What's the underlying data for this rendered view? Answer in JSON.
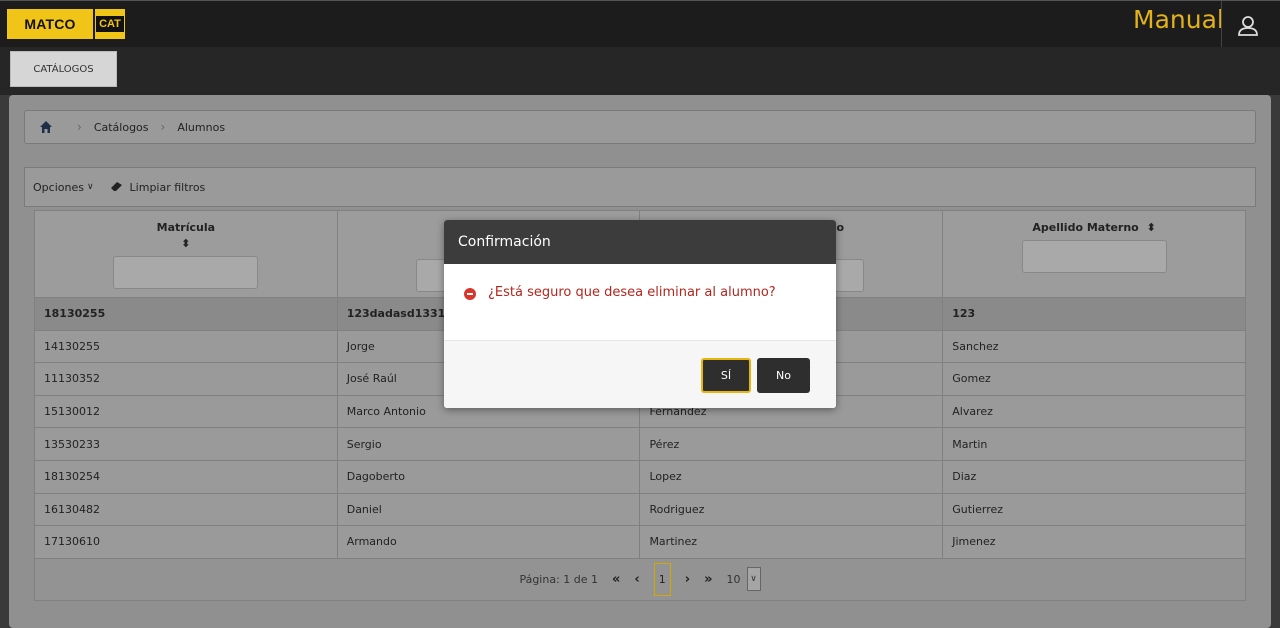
{
  "header": {
    "logo_text": "MATCO",
    "logo_cat": "CAT",
    "user_name": "Manual"
  },
  "tabs": [
    {
      "label": "CATÁLOGOS"
    }
  ],
  "breadcrumb": {
    "items": [
      "Catálogos",
      "Alumnos"
    ]
  },
  "toolbar": {
    "options_label": "Opciones",
    "clear_filters_label": "Limpiar filtros"
  },
  "table": {
    "columns": [
      "Matrícula",
      "",
      "",
      "Apellido Materno"
    ],
    "rows": [
      [
        "18130255",
        "123dadasd1331",
        "",
        "123"
      ],
      [
        "14130255",
        "Jorge",
        "",
        "Sanchez"
      ],
      [
        "11130352",
        "José Raúl",
        "",
        "Gomez"
      ],
      [
        "15130012",
        "Marco Antonio",
        "Fernandez",
        "Alvarez"
      ],
      [
        "13530233",
        "Sergio",
        "Pérez",
        "Martin"
      ],
      [
        "18130254",
        "Dagoberto",
        "Lopez",
        "Diaz"
      ],
      [
        "16130482",
        "Daniel",
        "Rodriguez",
        "Gutierrez"
      ],
      [
        "17130610",
        "Armando",
        "Martinez",
        "Jimenez"
      ]
    ],
    "column3_header_fragment": "o"
  },
  "pager": {
    "page_text": "Página: 1 de 1",
    "current_page": "1",
    "page_size": "10"
  },
  "modal": {
    "title": "Confirmación",
    "message": "¿Está seguro que desea eliminar al alumno?",
    "yes_label": "SÍ",
    "no_label": "No"
  },
  "colors": {
    "accent": "#e3b21a",
    "danger": "#d9362b",
    "header_bg": "#1c1c1c"
  }
}
